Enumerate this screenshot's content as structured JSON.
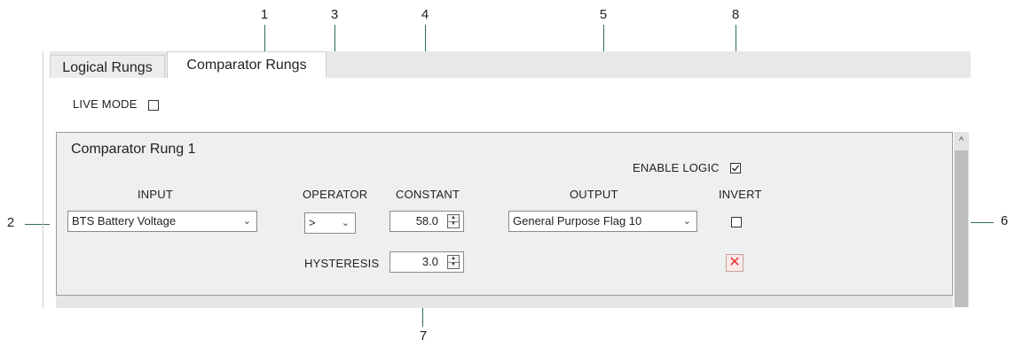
{
  "callouts": [
    "1",
    "2",
    "3",
    "4",
    "5",
    "6",
    "7",
    "8"
  ],
  "tabs": [
    {
      "label": "Logical Rungs",
      "active": false
    },
    {
      "label": "Comparator Rungs",
      "active": true
    }
  ],
  "live_mode": {
    "label": "LIVE MODE",
    "checked": false
  },
  "rung": {
    "title": "Comparator Rung 1",
    "enable_logic": {
      "label": "ENABLE LOGIC",
      "checked": true
    },
    "headers": {
      "input": "INPUT",
      "operator": "OPERATOR",
      "constant": "CONSTANT",
      "output": "OUTPUT",
      "invert": "INVERT"
    },
    "input_value": "BTS Battery Voltage",
    "operator_value": ">",
    "constant_value": "58.0",
    "output_value": "General Purpose Flag 10",
    "invert_checked": false,
    "hysteresis_label": "HYSTERESIS",
    "hysteresis_value": "3.0"
  },
  "icons": {
    "chevron": "chevron-down-icon",
    "check": "check-icon",
    "delete": "close-icon",
    "scroll_up": "chevron-up-icon"
  },
  "colors": {
    "callout_line": "#2f6b63",
    "panel_bg": "#efefef",
    "delete_x": "#dd3333"
  }
}
